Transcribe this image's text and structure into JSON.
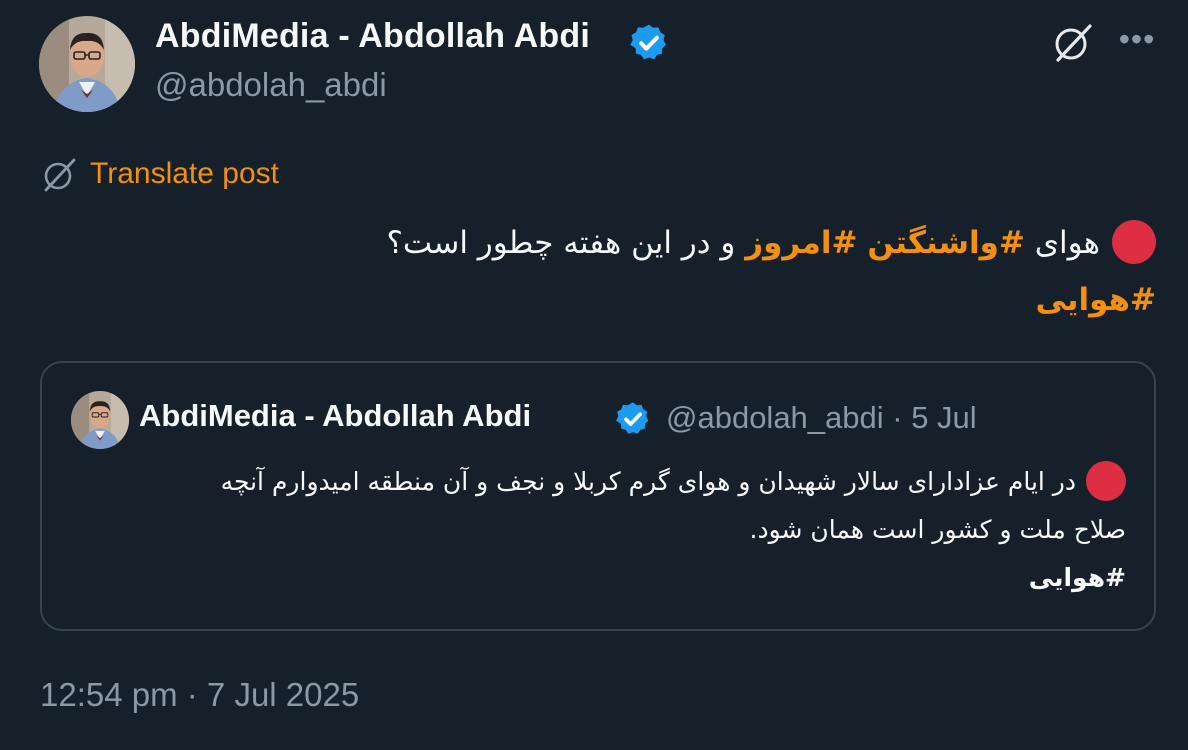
{
  "post": {
    "author_name": "AbdiMedia - Abdollah Abdi",
    "author_handle": "@abdolah_abdi",
    "translate_label": "Translate post",
    "line1_prefix": "هوای ",
    "hashtag1": "#واشنگتن",
    "hashtag2": "#امروز",
    "line1_suffix": " و در این هفته چطور است؟",
    "hashtag3": "#هوایی",
    "timestamp": "12:54 pm · 7 Jul 2025"
  },
  "quote": {
    "author_name": "AbdiMedia - Abdollah Abdi",
    "handle_date": "@abdolah_abdi · 5 Jul",
    "text_line1": "در ایام عزادارای سالار شهیدان و هوای گرم کربلا و نجف و آن منطقه امیدوارم آنچه",
    "text_line2": "صلاح ملت و کشور است همان شود.",
    "hashtag": "#هوایی"
  },
  "icons": {
    "verified": "verified-badge-icon",
    "grok": "grok-icon",
    "more": "more-icon",
    "translate": "grok-translate-icon",
    "red_circle": "red-circle-emoji"
  },
  "colors": {
    "background": "#15202b",
    "accent": "#f4900c",
    "verified": "#1d9bf0",
    "muted": "#8b98a5",
    "red_circle": "#dd2e44"
  }
}
